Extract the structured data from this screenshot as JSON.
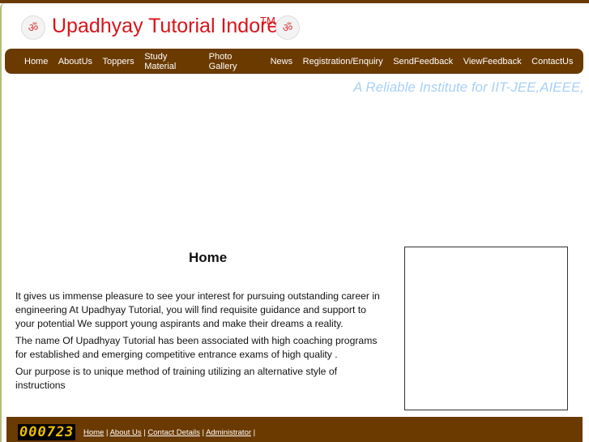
{
  "header": {
    "title": "Upadhyay Tutorial Indore",
    "trademark": "TM",
    "logo_icon": "om-icon"
  },
  "nav": {
    "items": [
      "Home",
      "AboutUs",
      "Toppers",
      "Study Material",
      "Photo Gallery",
      "News",
      "Registration/Enquiry",
      "SendFeedback",
      "ViewFeedback",
      "ContactUs"
    ]
  },
  "tagline": "A Reliable Institute for IIT-JEE,AIEEE,",
  "main": {
    "heading": "Home",
    "paragraphs": [
      "It gives us immense pleasure to see your interest for pursuing outstanding career in engineering At Upadhyay Tutorial, you will find requisite guidance and support to your potential We support young aspirants and make their dreams a reality.",
      "The name Of Upadhyay Tutorial has been associated with high coaching programs for established and emerging competitive entrance exams of high quality .",
      "Our purpose is to unique method of training utilizing an alternative style of instructions"
    ]
  },
  "footer": {
    "counter": "000723",
    "links": [
      "Home",
      "About Us",
      "Contact Details",
      "Administrator"
    ]
  },
  "colors": {
    "brand_brown": "#6b3a00",
    "title_red": "#d9141a",
    "tagline_blue": "#a9d0f8",
    "counter_yellow": "#f0c000"
  }
}
